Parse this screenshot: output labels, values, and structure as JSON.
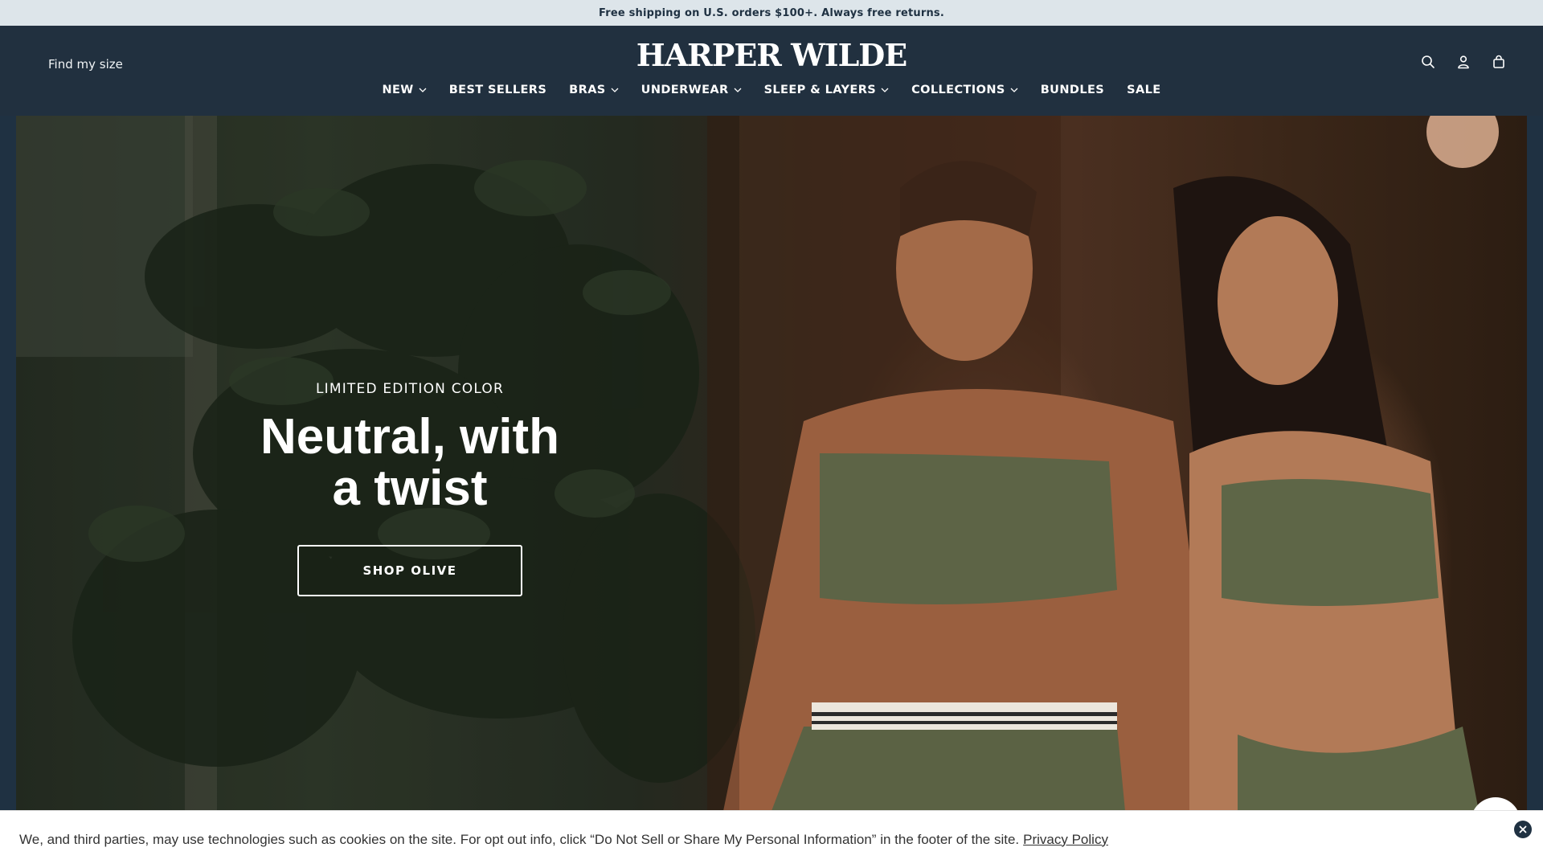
{
  "announcement": {
    "text": "Free shipping on U.S. orders $100+. Always free returns."
  },
  "header": {
    "find_size": "Find my size",
    "logo": "HARPER WILDE",
    "icons": [
      "search-icon",
      "account-icon",
      "cart-icon"
    ],
    "nav": [
      {
        "label": "NEW",
        "dropdown": true
      },
      {
        "label": "BEST SELLERS",
        "dropdown": false
      },
      {
        "label": "BRAS",
        "dropdown": true
      },
      {
        "label": "UNDERWEAR",
        "dropdown": true
      },
      {
        "label": "SLEEP & LAYERS",
        "dropdown": true
      },
      {
        "label": "COLLECTIONS",
        "dropdown": true
      },
      {
        "label": "BUNDLES",
        "dropdown": false
      },
      {
        "label": "SALE",
        "dropdown": false
      }
    ]
  },
  "hero": {
    "eyebrow": "LIMITED EDITION COLOR",
    "headline_line1": "Neutral, with",
    "headline_line2": "a twist",
    "cta": "SHOP OLIVE"
  },
  "cookie_banner": {
    "text": "We, and third parties, may use technologies such as cookies on the site. For opt out info, click “Do Not Sell or Share My Personal Information” in the footer of the site.",
    "policy_link": "Privacy Policy"
  },
  "colors": {
    "navy": "#21303f",
    "announcement_bg": "#dde5ea",
    "olive": "#5e6647"
  }
}
